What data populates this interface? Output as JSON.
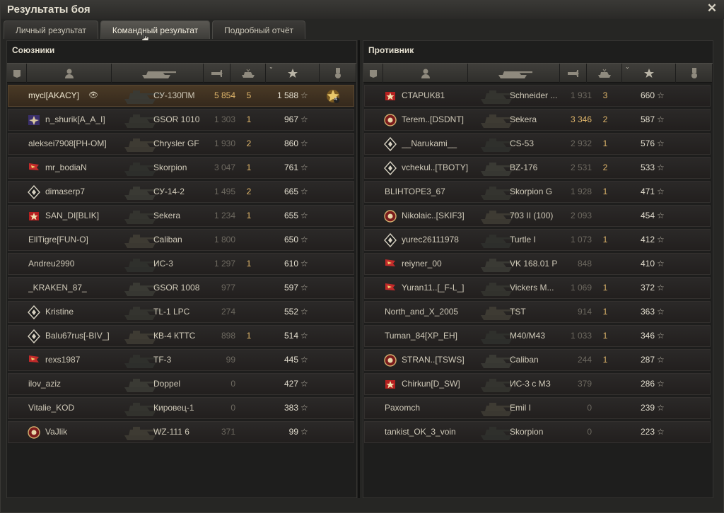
{
  "window": {
    "title": "Результаты боя",
    "close_icon": "close-icon"
  },
  "tabs": [
    {
      "label": "Личный результат",
      "active": false
    },
    {
      "label": "Командный результат",
      "active": true
    },
    {
      "label": "Подробный отчёт",
      "active": false
    }
  ],
  "columns": [
    "squad-icon",
    "player-icon",
    "tank-icon",
    "damage-icon",
    "kills-icon",
    "xp-star-icon",
    "medal-icon"
  ],
  "colors": {
    "highlight": "#e1b76b",
    "muted": "#6d6960",
    "text": "#cfc9b8"
  },
  "allies": {
    "title": "Союзники",
    "rows": [
      {
        "player": "mycl[AKACY]",
        "emblem": "none",
        "tank": "СУ-130ПМ",
        "damage": "5 854",
        "kills": "5",
        "xp": "1 588",
        "me": true,
        "medal": "achievement-medal-icon",
        "medal_count": "4"
      },
      {
        "player": "n_shurik[A_A_I]",
        "emblem": "clan-emblem-icon",
        "tank": "GSOR 1010",
        "damage": "1 303",
        "kills": "1",
        "xp": "967"
      },
      {
        "player": "aleksei7908[PH-OM]",
        "emblem": "none",
        "tank": "Chrysler GF",
        "damage": "1 930",
        "kills": "2",
        "xp": "860"
      },
      {
        "player": "mr_bodiaN",
        "emblem": "flag-emblem-icon",
        "tank": "Skorpion",
        "damage": "3 047",
        "kills": "1",
        "xp": "761"
      },
      {
        "player": "dimaserp7",
        "emblem": "diamond-emblem-icon",
        "tank": "СУ-14-2",
        "damage": "1 495",
        "kills": "2",
        "xp": "665"
      },
      {
        "player": "SAN_DI[BLIK]",
        "emblem": "star-emblem-icon",
        "tank": "Sekera",
        "damage": "1 234",
        "kills": "1",
        "xp": "655"
      },
      {
        "player": "EllTigre[FUN-O]",
        "emblem": "none",
        "tank": "Caliban",
        "damage": "1 800",
        "kills": "",
        "xp": "650"
      },
      {
        "player": "Andreu2990",
        "emblem": "none",
        "tank": "ИС-3",
        "damage": "1 297",
        "kills": "1",
        "xp": "610"
      },
      {
        "player": "_KRAKEN_87_",
        "emblem": "none",
        "tank": "GSOR 1008",
        "damage": "977",
        "kills": "",
        "xp": "597"
      },
      {
        "player": "Kristine",
        "emblem": "diamond-emblem-icon",
        "tank": "TL-1 LPC",
        "damage": "274",
        "kills": "",
        "xp": "552"
      },
      {
        "player": "Balu67rus[-BIV_]",
        "emblem": "diamond-emblem-icon",
        "tank": "КВ-4 КТТС",
        "damage": "898",
        "kills": "1",
        "xp": "514"
      },
      {
        "player": "rexs1987",
        "emblem": "flag-emblem-icon",
        "tank": "TF-3",
        "damage": "99",
        "kills": "",
        "xp": "445"
      },
      {
        "player": "ilov_aziz",
        "emblem": "none",
        "tank": "Doppel",
        "damage": "0",
        "kills": "",
        "xp": "427"
      },
      {
        "player": "Vitalie_KOD",
        "emblem": "none",
        "tank": "Кировец-1",
        "damage": "0",
        "kills": "",
        "xp": "383"
      },
      {
        "player": "VaJlik",
        "emblem": "round-emblem-icon",
        "tank": "WZ-111 6",
        "damage": "371",
        "kills": "",
        "xp": "99"
      }
    ]
  },
  "enemies": {
    "title": "Противник",
    "rows": [
      {
        "player": "CTAPUK81",
        "emblem": "star-emblem-icon",
        "tank": "Schneider ...",
        "damage": "1 931",
        "kills": "3",
        "xp": "660"
      },
      {
        "player": "Terem..[DSDNT]",
        "emblem": "round-emblem-icon",
        "tank": "Sekera",
        "damage": "3 346",
        "kills": "2",
        "xp": "587",
        "dmg_hi": true
      },
      {
        "player": "__Narukami__",
        "emblem": "diamond-emblem-icon",
        "tank": "CS-53",
        "damage": "2 932",
        "kills": "1",
        "xp": "576"
      },
      {
        "player": "vchekul..[TBOTY]",
        "emblem": "diamond-emblem-icon",
        "tank": "BZ-176",
        "damage": "2 531",
        "kills": "2",
        "xp": "533"
      },
      {
        "player": "BLIHTOPE3_67",
        "emblem": "none",
        "tank": "Skorpion G",
        "damage": "1 928",
        "kills": "1",
        "xp": "471"
      },
      {
        "player": "Nikolaic..[SKIF3]",
        "emblem": "round-emblem-icon",
        "tank": "703 II (100)",
        "damage": "2 093",
        "kills": "",
        "xp": "454"
      },
      {
        "player": "yurec26111978",
        "emblem": "diamond-emblem-icon",
        "tank": "Turtle I",
        "damage": "1 073",
        "kills": "1",
        "xp": "412"
      },
      {
        "player": "reiyner_00",
        "emblem": "flag-emblem-icon",
        "tank": "VK 168.01 P",
        "damage": "848",
        "kills": "",
        "xp": "410"
      },
      {
        "player": "Yuran11..[_F-L_]",
        "emblem": "flag-emblem-icon",
        "tank": "Vickers M...",
        "damage": "1 069",
        "kills": "1",
        "xp": "372"
      },
      {
        "player": "North_and_X_2005",
        "emblem": "none",
        "tank": "TST",
        "damage": "914",
        "kills": "1",
        "xp": "363"
      },
      {
        "player": "Tuman_84[XP_EH]",
        "emblem": "none",
        "tank": "M40/M43",
        "damage": "1 033",
        "kills": "1",
        "xp": "346"
      },
      {
        "player": "STRAN..[TSWS]",
        "emblem": "round-emblem-icon",
        "tank": "Caliban",
        "damage": "244",
        "kills": "1",
        "xp": "287"
      },
      {
        "player": "Chirkun[D_SW]",
        "emblem": "star-emblem-icon",
        "tank": "ИС-3 с МЗ",
        "damage": "379",
        "kills": "",
        "xp": "286"
      },
      {
        "player": "Paxomch",
        "emblem": "none",
        "tank": "Emil I",
        "damage": "0",
        "kills": "",
        "xp": "239"
      },
      {
        "player": "tankist_OK_3_voin",
        "emblem": "none",
        "tank": "Skorpion",
        "damage": "0",
        "kills": "",
        "xp": "223"
      }
    ]
  }
}
